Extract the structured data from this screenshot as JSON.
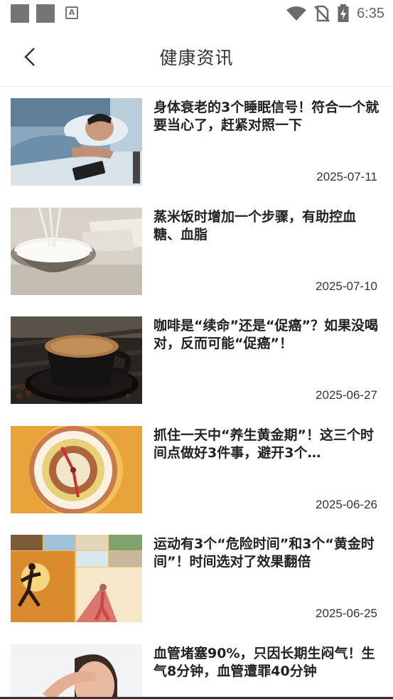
{
  "status_bar": {
    "time": "6:35",
    "icons": [
      "notification-square-icon",
      "notification-square-icon",
      "app-a-icon",
      "wifi-icon",
      "no-sim-icon",
      "battery-charging-icon"
    ]
  },
  "header": {
    "title": "健康资讯",
    "back_icon": "chevron-left-icon"
  },
  "news": [
    {
      "title": "身体衰老的3个睡眠信号！符合一个就要当心了，赶紧对照一下",
      "date": "2025-07-11",
      "image": "sleeping-man-photo"
    },
    {
      "title": "蒸米饭时增加一个步骤，有助控血糖、血脂",
      "date": "2025-07-10",
      "image": "rice-bowl-photo"
    },
    {
      "title": "咖啡是“续命”还是“促癌”？如果没喝对，反而可能“促癌”！",
      "date": "2025-06-27",
      "image": "coffee-cup-photo"
    },
    {
      "title": "抓住一天中“养生黄金期”！这三个时间点做好3件事，避开3个…",
      "date": "2025-06-26",
      "image": "clock-dial-photo"
    },
    {
      "title": "运动有3个“危险时间”和3个“黄金时间”！时间选对了效果翻倍",
      "date": "2025-06-25",
      "image": "running-collage-photo"
    },
    {
      "title": "血管堵塞90%，只因长期生闷气！生气8分钟，血管遭罪40分钟",
      "date": "",
      "image": "headache-woman-photo"
    }
  ]
}
